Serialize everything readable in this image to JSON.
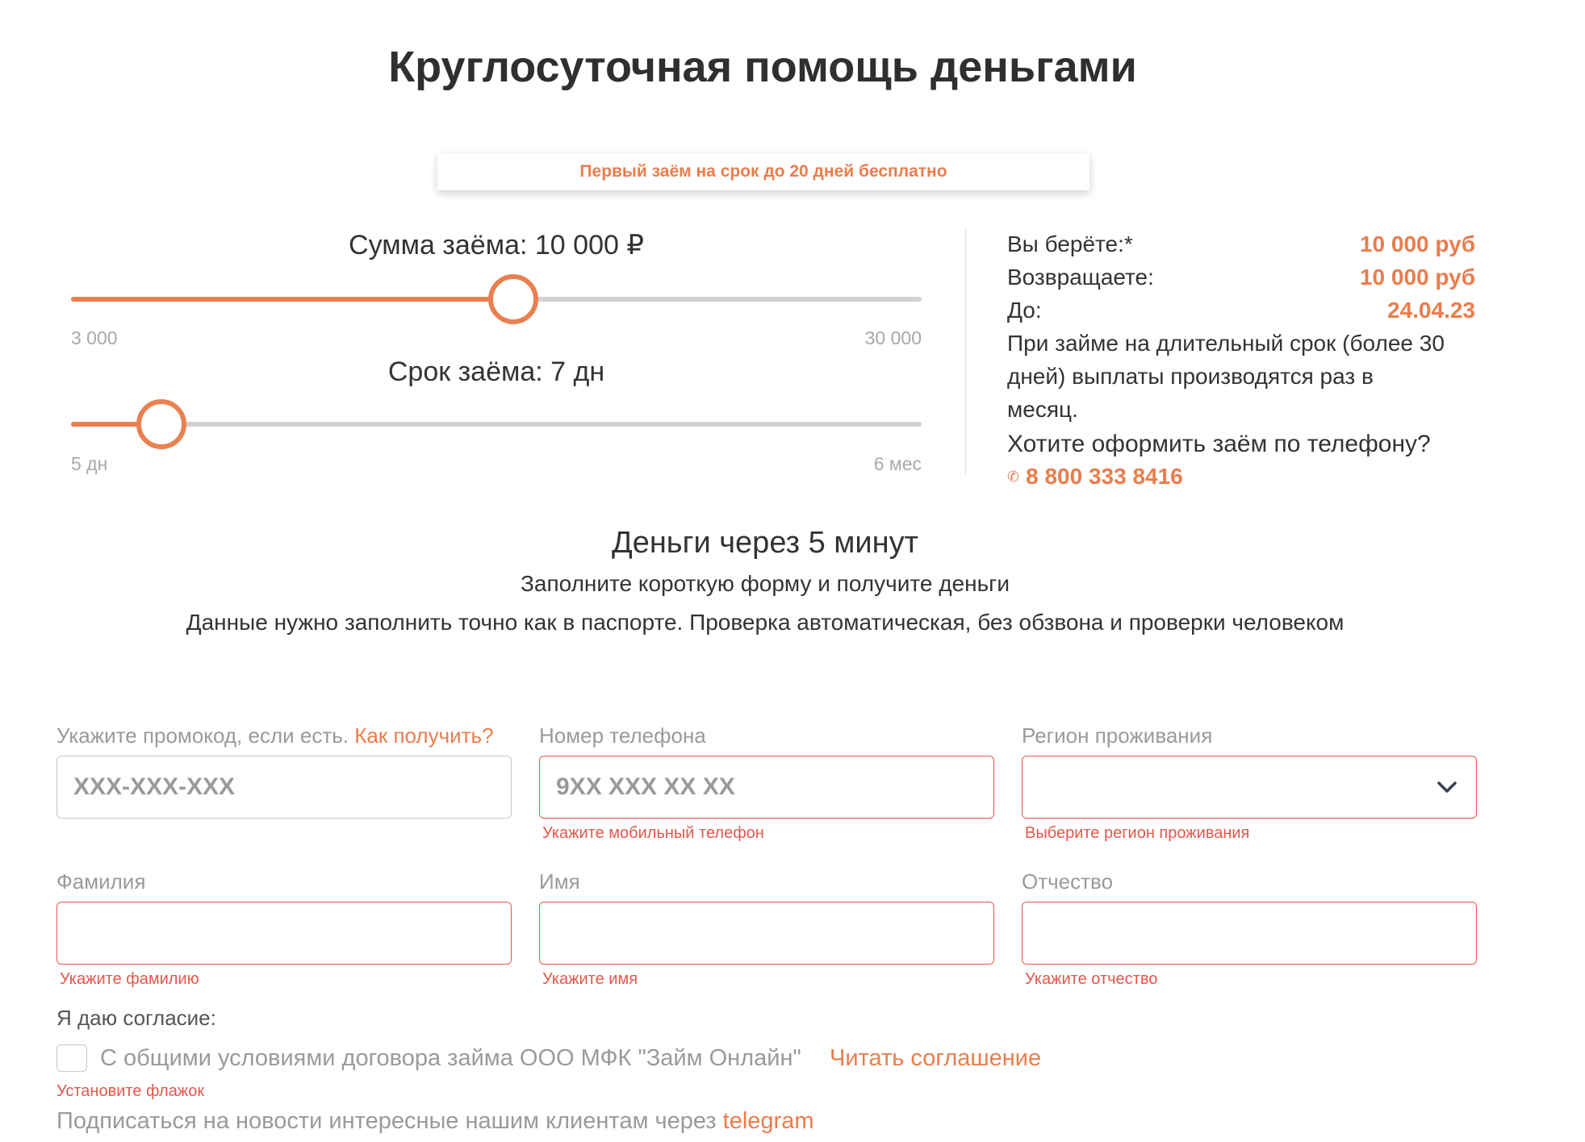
{
  "header": {
    "title": "Круглосуточная помощь деньгами",
    "promo_banner": "Первый заём на срок до 20 дней бесплатно"
  },
  "amount_slider": {
    "label": "Сумма заёма: 10 000 ₽",
    "min_label": "3 000",
    "max_label": "30 000",
    "value": 10000,
    "min": 3000,
    "max": 30000,
    "position_fraction": 0.52
  },
  "term_slider": {
    "label": "Срок заёма: 7 дн",
    "min_label": "5 дн",
    "max_label": "6 мес",
    "position_fraction": 0.106
  },
  "summary": {
    "take_label": "Вы берёте:*",
    "take_value": "10 000 руб",
    "return_label": "Возвращаете:",
    "return_value": "10 000 руб",
    "until_label": "До:",
    "until_value": "24.04.23",
    "note_line1": "При займе на длительный срок (более 30",
    "note_line2": "дней) выплаты производятся раз в",
    "note_line3": "месяц.",
    "question": "Хотите оформить заём по телефону?",
    "phone_icon": "phone-icon",
    "phone": "8 800 333 8416"
  },
  "intro": {
    "heading": "Деньги через 5 минут",
    "fill_text": "Заполните короткую форму и получите деньги",
    "exact_text": "Данные нужно заполнить точно как в паспорте. Проверка автоматическая, без обзвона и проверки человеком"
  },
  "form": {
    "promo": {
      "label": "Укажите промокод, если есть.",
      "link": "Как получить?",
      "placeholder": "XXX-XXX-XXX"
    },
    "phone": {
      "label": "Номер телефона",
      "placeholder": "9XX XXX XX XX",
      "error": "Укажите мобильный телефон"
    },
    "region": {
      "label": "Регион проживания",
      "value": "",
      "error": "Выберите регион проживания",
      "icon": "chevron-down-icon"
    },
    "lastname": {
      "label": "Фамилия",
      "value": "",
      "error": "Укажите фамилию"
    },
    "firstname": {
      "label": "Имя",
      "value": "",
      "error": "Укажите имя"
    },
    "middlename": {
      "label": "Отчество",
      "value": "",
      "error": "Укажите отчество"
    },
    "consent": {
      "label": "Я даю согласие:",
      "checked": false,
      "text": "С общими условиями договора займа ООО МФК \"Займ Онлайн\"",
      "link": "Читать соглашение",
      "error": "Установите флажок"
    },
    "subscribe": {
      "text": "Подписаться на новости интересные нашим клиентам через",
      "link": "telegram"
    }
  },
  "colors": {
    "accent": "#ea7d4c",
    "error": "#e2574c",
    "track": "#d1d1d1",
    "muted": "#9a9a9a"
  }
}
